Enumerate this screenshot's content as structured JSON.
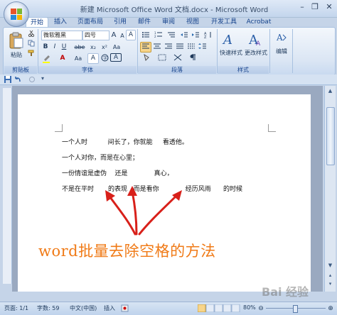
{
  "window": {
    "title": "新建 Microsoft Office Word 文档.docx - Microsoft Word",
    "minimize": "–",
    "restore": "❐",
    "close": "✕"
  },
  "tabs": [
    "开始",
    "插入",
    "页面布局",
    "引用",
    "邮件",
    "审阅",
    "视图",
    "开发工具",
    "Acrobat"
  ],
  "ribbon": {
    "clipboard": {
      "paste": "粘贴",
      "label": "剪贴板"
    },
    "font": {
      "family": "微软雅黑",
      "size": "四号",
      "label": "字体",
      "bold": "B",
      "italic": "I",
      "underline": "U",
      "strike": "abe",
      "subscript": "x₂",
      "superscript": "x²",
      "case": "Aa",
      "grow": "A",
      "shrink": "A",
      "wen": "变",
      "charborder": "A"
    },
    "paragraph": {
      "label": "段落"
    },
    "styles": {
      "quick": "快速样式",
      "change": "更改样式",
      "label": "样式"
    },
    "editing": {
      "label": "编辑"
    }
  },
  "document": {
    "lines": [
      "一个人时          间长了，你就能     看透他。",
      "一个人对你，而是在心里；",
      "一份情谊是虚伪    还是             真心，",
      "不是在平时       的表现   而是看你             经历风雨      的时候"
    ],
    "overlay": "word批量去除空格的方法"
  },
  "status": {
    "page": "页面: 1/1",
    "words": "字数: 59",
    "language": "中文(中国)",
    "mode": "插入",
    "zoom": "80%"
  },
  "watermark": "Bai 经验",
  "colors": {
    "accent": "#f07a16",
    "ribbon": "#dbe6f4",
    "arrow": "#d8201a"
  }
}
